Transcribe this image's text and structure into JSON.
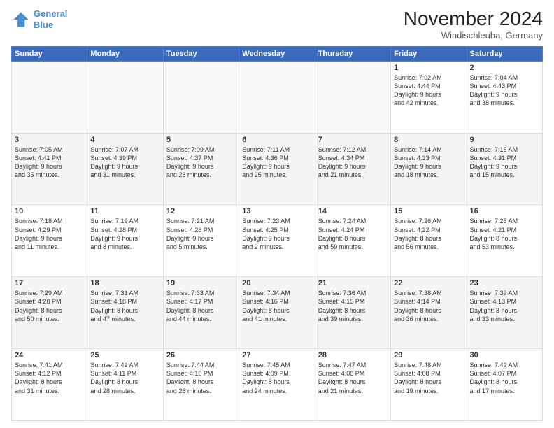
{
  "header": {
    "logo_line1": "General",
    "logo_line2": "Blue",
    "month_title": "November 2024",
    "location": "Windischleuba, Germany"
  },
  "weekdays": [
    "Sunday",
    "Monday",
    "Tuesday",
    "Wednesday",
    "Thursday",
    "Friday",
    "Saturday"
  ],
  "weeks": [
    [
      {
        "day": "",
        "info": ""
      },
      {
        "day": "",
        "info": ""
      },
      {
        "day": "",
        "info": ""
      },
      {
        "day": "",
        "info": ""
      },
      {
        "day": "",
        "info": ""
      },
      {
        "day": "1",
        "info": "Sunrise: 7:02 AM\nSunset: 4:44 PM\nDaylight: 9 hours\nand 42 minutes."
      },
      {
        "day": "2",
        "info": "Sunrise: 7:04 AM\nSunset: 4:43 PM\nDaylight: 9 hours\nand 38 minutes."
      }
    ],
    [
      {
        "day": "3",
        "info": "Sunrise: 7:05 AM\nSunset: 4:41 PM\nDaylight: 9 hours\nand 35 minutes."
      },
      {
        "day": "4",
        "info": "Sunrise: 7:07 AM\nSunset: 4:39 PM\nDaylight: 9 hours\nand 31 minutes."
      },
      {
        "day": "5",
        "info": "Sunrise: 7:09 AM\nSunset: 4:37 PM\nDaylight: 9 hours\nand 28 minutes."
      },
      {
        "day": "6",
        "info": "Sunrise: 7:11 AM\nSunset: 4:36 PM\nDaylight: 9 hours\nand 25 minutes."
      },
      {
        "day": "7",
        "info": "Sunrise: 7:12 AM\nSunset: 4:34 PM\nDaylight: 9 hours\nand 21 minutes."
      },
      {
        "day": "8",
        "info": "Sunrise: 7:14 AM\nSunset: 4:33 PM\nDaylight: 9 hours\nand 18 minutes."
      },
      {
        "day": "9",
        "info": "Sunrise: 7:16 AM\nSunset: 4:31 PM\nDaylight: 9 hours\nand 15 minutes."
      }
    ],
    [
      {
        "day": "10",
        "info": "Sunrise: 7:18 AM\nSunset: 4:29 PM\nDaylight: 9 hours\nand 11 minutes."
      },
      {
        "day": "11",
        "info": "Sunrise: 7:19 AM\nSunset: 4:28 PM\nDaylight: 9 hours\nand 8 minutes."
      },
      {
        "day": "12",
        "info": "Sunrise: 7:21 AM\nSunset: 4:26 PM\nDaylight: 9 hours\nand 5 minutes."
      },
      {
        "day": "13",
        "info": "Sunrise: 7:23 AM\nSunset: 4:25 PM\nDaylight: 9 hours\nand 2 minutes."
      },
      {
        "day": "14",
        "info": "Sunrise: 7:24 AM\nSunset: 4:24 PM\nDaylight: 8 hours\nand 59 minutes."
      },
      {
        "day": "15",
        "info": "Sunrise: 7:26 AM\nSunset: 4:22 PM\nDaylight: 8 hours\nand 56 minutes."
      },
      {
        "day": "16",
        "info": "Sunrise: 7:28 AM\nSunset: 4:21 PM\nDaylight: 8 hours\nand 53 minutes."
      }
    ],
    [
      {
        "day": "17",
        "info": "Sunrise: 7:29 AM\nSunset: 4:20 PM\nDaylight: 8 hours\nand 50 minutes."
      },
      {
        "day": "18",
        "info": "Sunrise: 7:31 AM\nSunset: 4:18 PM\nDaylight: 8 hours\nand 47 minutes."
      },
      {
        "day": "19",
        "info": "Sunrise: 7:33 AM\nSunset: 4:17 PM\nDaylight: 8 hours\nand 44 minutes."
      },
      {
        "day": "20",
        "info": "Sunrise: 7:34 AM\nSunset: 4:16 PM\nDaylight: 8 hours\nand 41 minutes."
      },
      {
        "day": "21",
        "info": "Sunrise: 7:36 AM\nSunset: 4:15 PM\nDaylight: 8 hours\nand 39 minutes."
      },
      {
        "day": "22",
        "info": "Sunrise: 7:38 AM\nSunset: 4:14 PM\nDaylight: 8 hours\nand 36 minutes."
      },
      {
        "day": "23",
        "info": "Sunrise: 7:39 AM\nSunset: 4:13 PM\nDaylight: 8 hours\nand 33 minutes."
      }
    ],
    [
      {
        "day": "24",
        "info": "Sunrise: 7:41 AM\nSunset: 4:12 PM\nDaylight: 8 hours\nand 31 minutes."
      },
      {
        "day": "25",
        "info": "Sunrise: 7:42 AM\nSunset: 4:11 PM\nDaylight: 8 hours\nand 28 minutes."
      },
      {
        "day": "26",
        "info": "Sunrise: 7:44 AM\nSunset: 4:10 PM\nDaylight: 8 hours\nand 26 minutes."
      },
      {
        "day": "27",
        "info": "Sunrise: 7:45 AM\nSunset: 4:09 PM\nDaylight: 8 hours\nand 24 minutes."
      },
      {
        "day": "28",
        "info": "Sunrise: 7:47 AM\nSunset: 4:08 PM\nDaylight: 8 hours\nand 21 minutes."
      },
      {
        "day": "29",
        "info": "Sunrise: 7:48 AM\nSunset: 4:08 PM\nDaylight: 8 hours\nand 19 minutes."
      },
      {
        "day": "30",
        "info": "Sunrise: 7:49 AM\nSunset: 4:07 PM\nDaylight: 8 hours\nand 17 minutes."
      }
    ]
  ]
}
